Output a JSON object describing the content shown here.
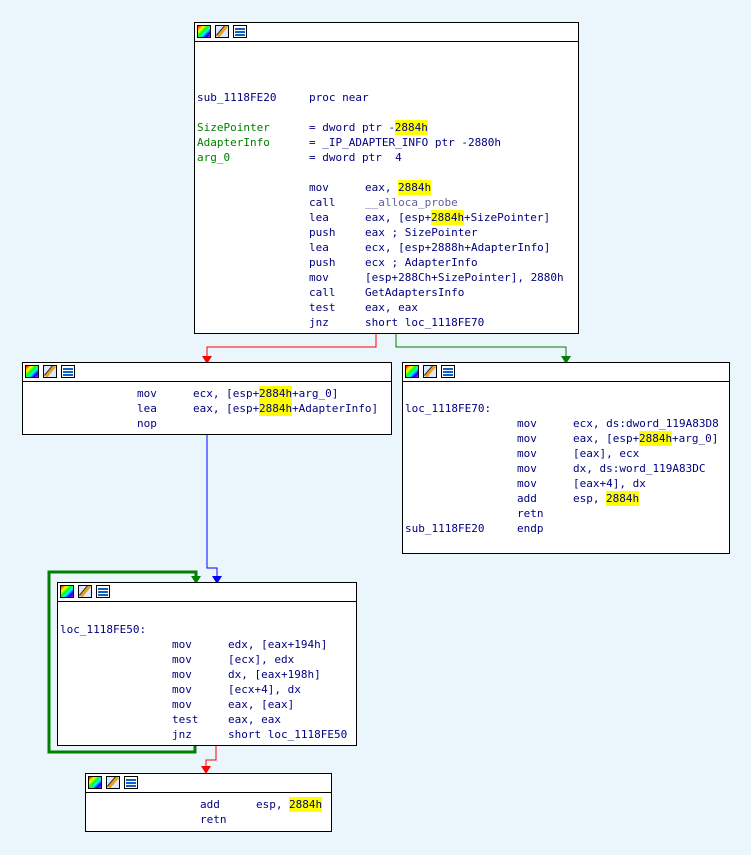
{
  "nodes": {
    "entry": {
      "proc_label": "sub_1118FE20",
      "proc_kw": "proc near",
      "vars": [
        {
          "name": "SizePointer",
          "eq": "= dword ptr -",
          "hl": "2884h",
          "rest": ""
        },
        {
          "name": "AdapterInfo",
          "eq": "= _IP_ADAPTER_INFO ptr -2880h",
          "hl": "",
          "rest": ""
        },
        {
          "name": "arg_0",
          "eq": "= dword ptr  4",
          "hl": "",
          "rest": ""
        }
      ],
      "code": [
        {
          "op": "mov",
          "a": "eax, ",
          "hl": "2884h",
          "b": ""
        },
        {
          "op": "call",
          "a": "",
          "hl": "",
          "b": "__alloca_probe"
        },
        {
          "op": "lea",
          "a": "eax, [esp+",
          "hl": "2884h",
          "b": "+SizePointer]"
        },
        {
          "op": "push",
          "a": "eax ; SizePointer",
          "hl": "",
          "b": ""
        },
        {
          "op": "lea",
          "a": "ecx, [esp+2888h+AdapterInfo]",
          "hl": "",
          "b": ""
        },
        {
          "op": "push",
          "a": "ecx ; AdapterInfo",
          "hl": "",
          "b": ""
        },
        {
          "op": "mov",
          "a": "[esp+288Ch+SizePointer], 2880h",
          "hl": "",
          "b": ""
        },
        {
          "op": "call",
          "a": "GetAdaptersInfo",
          "hl": "",
          "b": ""
        },
        {
          "op": "test",
          "a": "eax, eax",
          "hl": "",
          "b": ""
        },
        {
          "op": "jnz",
          "a": "short loc_1118FE70",
          "hl": "",
          "b": ""
        }
      ]
    },
    "left": {
      "code": [
        {
          "op": "mov",
          "a": "ecx, [esp+",
          "hl": "2884h",
          "b": "+arg_0]"
        },
        {
          "op": "lea",
          "a": "eax, [esp+",
          "hl": "2884h",
          "b": "+AdapterInfo]"
        },
        {
          "op": "nop",
          "a": "",
          "hl": "",
          "b": ""
        }
      ]
    },
    "right": {
      "label": "loc_1118FE70:",
      "code": [
        {
          "op": "mov",
          "a": "ecx, ds:dword_119A83D8",
          "hl": "",
          "b": ""
        },
        {
          "op": "mov",
          "a": "eax, [esp+",
          "hl": "2884h",
          "b": "+arg_0]"
        },
        {
          "op": "mov",
          "a": "[eax], ecx",
          "hl": "",
          "b": ""
        },
        {
          "op": "mov",
          "a": "dx, ds:word_119A83DC",
          "hl": "",
          "b": ""
        },
        {
          "op": "mov",
          "a": "[eax+4], dx",
          "hl": "",
          "b": ""
        },
        {
          "op": "add",
          "a": "esp, ",
          "hl": "2884h",
          "b": ""
        },
        {
          "op": "retn",
          "a": "",
          "hl": "",
          "b": ""
        }
      ],
      "end_label": "sub_1118FE20",
      "end_kw": "endp"
    },
    "loop": {
      "label": "loc_1118FE50:",
      "code": [
        {
          "op": "mov",
          "a": "edx, [eax+194h]",
          "hl": "",
          "b": ""
        },
        {
          "op": "mov",
          "a": "[ecx], edx",
          "hl": "",
          "b": ""
        },
        {
          "op": "mov",
          "a": "dx, [eax+198h]",
          "hl": "",
          "b": ""
        },
        {
          "op": "mov",
          "a": "[ecx+4], dx",
          "hl": "",
          "b": ""
        },
        {
          "op": "mov",
          "a": "eax, [eax]",
          "hl": "",
          "b": ""
        },
        {
          "op": "test",
          "a": "eax, eax",
          "hl": "",
          "b": ""
        },
        {
          "op": "jnz",
          "a": "short loc_1118FE50",
          "hl": "",
          "b": ""
        }
      ]
    },
    "exit": {
      "code": [
        {
          "op": "add",
          "a": "esp, ",
          "hl": "2884h",
          "b": ""
        },
        {
          "op": "retn",
          "a": "",
          "hl": "",
          "b": ""
        }
      ]
    }
  },
  "icons": [
    "palette-icon",
    "edit-icon",
    "graph-icon"
  ],
  "colors": {
    "true_edge": "#008000",
    "false_edge": "#ff0000",
    "uncond_edge": "#0000ff",
    "highlight": "#ffff00",
    "background": "#eaf6fc"
  }
}
